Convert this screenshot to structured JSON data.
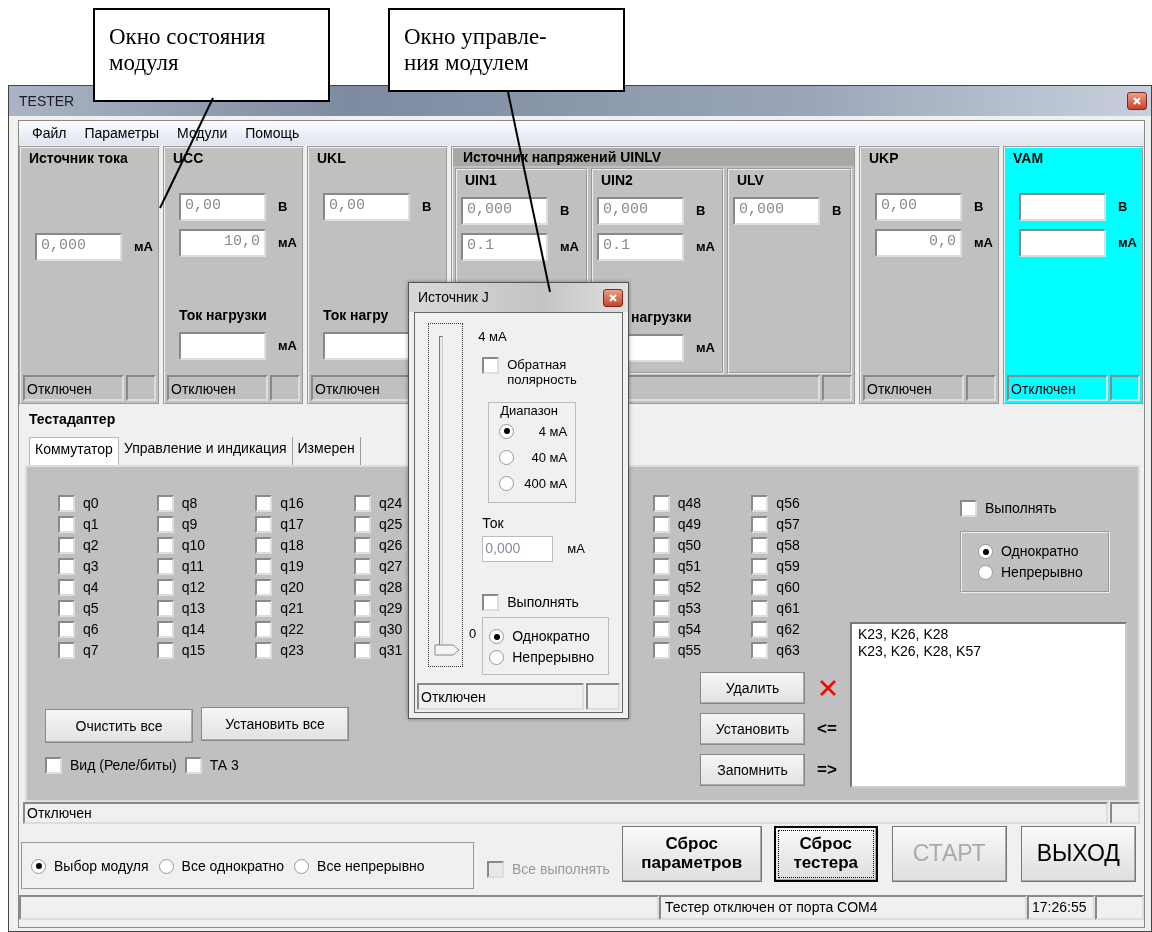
{
  "callouts": [
    {
      "lines": [
        "Окно состояния",
        "модуля"
      ]
    },
    {
      "lines": [
        "Окно управле-",
        "ния модулем"
      ]
    }
  ],
  "window": {
    "title": "TESTER"
  },
  "menu": [
    "Файл",
    "Параметры",
    "Модули",
    "Помощь"
  ],
  "modules": [
    {
      "kind": "panel",
      "title": "Источник тока",
      "active": false,
      "rows": [
        {
          "kind": "field",
          "value": "0,000",
          "unit": "мА"
        }
      ],
      "status": "Отключен"
    },
    {
      "kind": "panel",
      "title": "UCC",
      "active": false,
      "rows": [
        {
          "kind": "field",
          "value": "0,00",
          "unit": "В"
        },
        {
          "kind": "field",
          "value": "10,0",
          "align_right": true,
          "unit": "мА"
        },
        {
          "kind": "label",
          "text": "Ток нагрузки"
        },
        {
          "kind": "field",
          "unit": "мА"
        }
      ],
      "status": "Отключен"
    },
    {
      "kind": "panel",
      "title": "UKL",
      "active": false,
      "rows": [
        {
          "kind": "field",
          "value": "0,00",
          "unit": "В"
        },
        {
          "kind": "label",
          "text": "Ток нагру"
        },
        {
          "kind": "field"
        }
      ],
      "status": "Отключен"
    },
    {
      "kind": "group",
      "title": "Источник напряжений UINLV",
      "subpanels": [
        {
          "title": "UIN1",
          "rows": [
            {
              "kind": "field",
              "value": "0,000",
              "unit": "В"
            },
            {
              "kind": "field",
              "value": "0.1",
              "unit": "мА"
            }
          ]
        },
        {
          "title": "UIN2",
          "rows": [
            {
              "kind": "field",
              "value": "0,000",
              "unit": "В"
            },
            {
              "kind": "field",
              "value": "0.1",
              "unit": "мА"
            },
            {
              "kind": "label",
              "text": "нагрузки"
            },
            {
              "kind": "field",
              "unit": "мА"
            }
          ]
        },
        {
          "title": "ULV",
          "rows": [
            {
              "kind": "field",
              "value": "0,000",
              "unit": "В"
            }
          ]
        }
      ]
    },
    {
      "kind": "panel",
      "title": "UKP",
      "active": false,
      "rows": [
        {
          "kind": "field",
          "value": "0,00",
          "unit": "В"
        },
        {
          "kind": "field",
          "value": "0,0",
          "align_right": true,
          "unit": "мА"
        }
      ],
      "status": "Отключен"
    },
    {
      "kind": "panel",
      "title": "VAM",
      "active": true,
      "rows": [
        {
          "kind": "field",
          "unit": "В"
        },
        {
          "kind": "field",
          "unit": "мА"
        }
      ],
      "status": "Отключен"
    }
  ],
  "testadapter": {
    "title": "Тестадаптер",
    "tabs": [
      {
        "label": "Коммутатор",
        "selected": true
      },
      {
        "label": "Управление и индикация",
        "selected": false
      },
      {
        "label": "Измерен",
        "selected": false
      }
    ],
    "switch_columns": [
      [
        {
          "label": "q0",
          "checked": false
        },
        {
          "label": "q1",
          "checked": false
        },
        {
          "label": "q2",
          "checked": false
        },
        {
          "label": "q3",
          "checked": false
        },
        {
          "label": "q4",
          "checked": false
        },
        {
          "label": "q5",
          "checked": false
        },
        {
          "label": "q6",
          "checked": false
        },
        {
          "label": "q7",
          "checked": false
        }
      ],
      [
        {
          "label": "q8",
          "checked": false
        },
        {
          "label": "q9",
          "checked": false
        },
        {
          "label": "q10",
          "checked": false
        },
        {
          "label": "q11",
          "checked": false
        },
        {
          "label": "q12",
          "checked": false
        },
        {
          "label": "q13",
          "checked": false
        },
        {
          "label": "q14",
          "checked": false
        },
        {
          "label": "q15",
          "checked": false
        }
      ],
      [
        {
          "label": "q16",
          "checked": false
        },
        {
          "label": "q17",
          "checked": false
        },
        {
          "label": "q18",
          "checked": false
        },
        {
          "label": "q19",
          "checked": false
        },
        {
          "label": "q20",
          "checked": false
        },
        {
          "label": "q21",
          "checked": false
        },
        {
          "label": "q22",
          "checked": false
        },
        {
          "label": "q23",
          "checked": false
        }
      ],
      [
        {
          "label": "q24",
          "checked": false
        },
        {
          "label": "q25",
          "checked": false
        },
        {
          "label": "q26",
          "checked": false
        },
        {
          "label": "q27",
          "checked": false
        },
        {
          "label": "q28",
          "checked": false
        },
        {
          "label": "q29",
          "checked": false
        },
        {
          "label": "q30",
          "checked": false
        },
        {
          "label": "q31",
          "checked": false
        }
      ],
      [
        {
          "label": "q48",
          "checked": false
        },
        {
          "label": "q49",
          "checked": false
        },
        {
          "label": "q50",
          "checked": false
        },
        {
          "label": "q51",
          "checked": false
        },
        {
          "label": "q52",
          "checked": false
        },
        {
          "label": "q53",
          "checked": false
        },
        {
          "label": "q54",
          "checked": false
        },
        {
          "label": "q55",
          "checked": false
        }
      ],
      [
        {
          "label": "q56",
          "checked": false
        },
        {
          "label": "q57",
          "checked": false
        },
        {
          "label": "q58",
          "checked": false
        },
        {
          "label": "q59",
          "checked": false
        },
        {
          "label": "q60",
          "checked": false
        },
        {
          "label": "q61",
          "checked": false
        },
        {
          "label": "q62",
          "checked": false
        },
        {
          "label": "q63",
          "checked": false
        }
      ]
    ],
    "execute": {
      "label": "Выполнять",
      "checked": false
    },
    "mode": [
      {
        "label": "Однократно",
        "selected": true
      },
      {
        "label": "Непрерывно",
        "selected": false
      }
    ],
    "list_items": [
      "K23, K26, K28",
      "K23, K26, K28, K57"
    ],
    "action_buttons": [
      {
        "label": "Удалить",
        "kind": "cross"
      },
      {
        "label": "Установить",
        "kind": "text",
        "sign": "<="
      },
      {
        "label": "Запомнить",
        "kind": "text",
        "sign": "=>"
      }
    ],
    "left_buttons": [
      "Очистить все",
      "Установить все"
    ],
    "options": [
      {
        "label": "Вид (Реле/биты)",
        "checked": false
      },
      {
        "label": "ТА 3",
        "checked": false
      }
    ],
    "status": "Отключен"
  },
  "run_modes": [
    {
      "label": "Выбор модуля",
      "selected": true
    },
    {
      "label": "Все однократно",
      "selected": false
    },
    {
      "label": "Все непрерывно",
      "selected": false
    }
  ],
  "all_execute": {
    "label": "Все выполнять",
    "checked": false,
    "disabled": true
  },
  "buttons": [
    {
      "label": "Сброс параметров",
      "kind": "bold",
      "disabled": false,
      "focused": false
    },
    {
      "label": "Сброс тестера",
      "kind": "bold",
      "disabled": false,
      "focused": true
    },
    {
      "label": "СТАРТ",
      "kind": "large",
      "disabled": true,
      "focused": false
    },
    {
      "label": "ВЫХОД",
      "kind": "large",
      "disabled": false,
      "focused": false
    }
  ],
  "status_bar": {
    "message": "Тестер отключен от порта COM4",
    "time": "17:26:55"
  },
  "dialog": {
    "title": "Источник J",
    "slider": {
      "level": 0,
      "max_label": "4 мА",
      "min_label": "0"
    },
    "reverse": {
      "label": "Обратная полярность",
      "checked": false
    },
    "range": {
      "title": "Диапазон",
      "options": [
        {
          "label": "4 мА",
          "selected": true
        },
        {
          "label": "40 мА",
          "selected": false
        },
        {
          "label": "400 мА",
          "selected": false
        }
      ]
    },
    "current": {
      "label": "Ток",
      "value": "0,000",
      "unit": "мА"
    },
    "execute": {
      "label": "Выполнять",
      "checked": false
    },
    "mode": [
      {
        "label": "Однократно",
        "selected": true
      },
      {
        "label": "Непрерывно",
        "selected": false
      }
    ],
    "status": "Отключен"
  }
}
